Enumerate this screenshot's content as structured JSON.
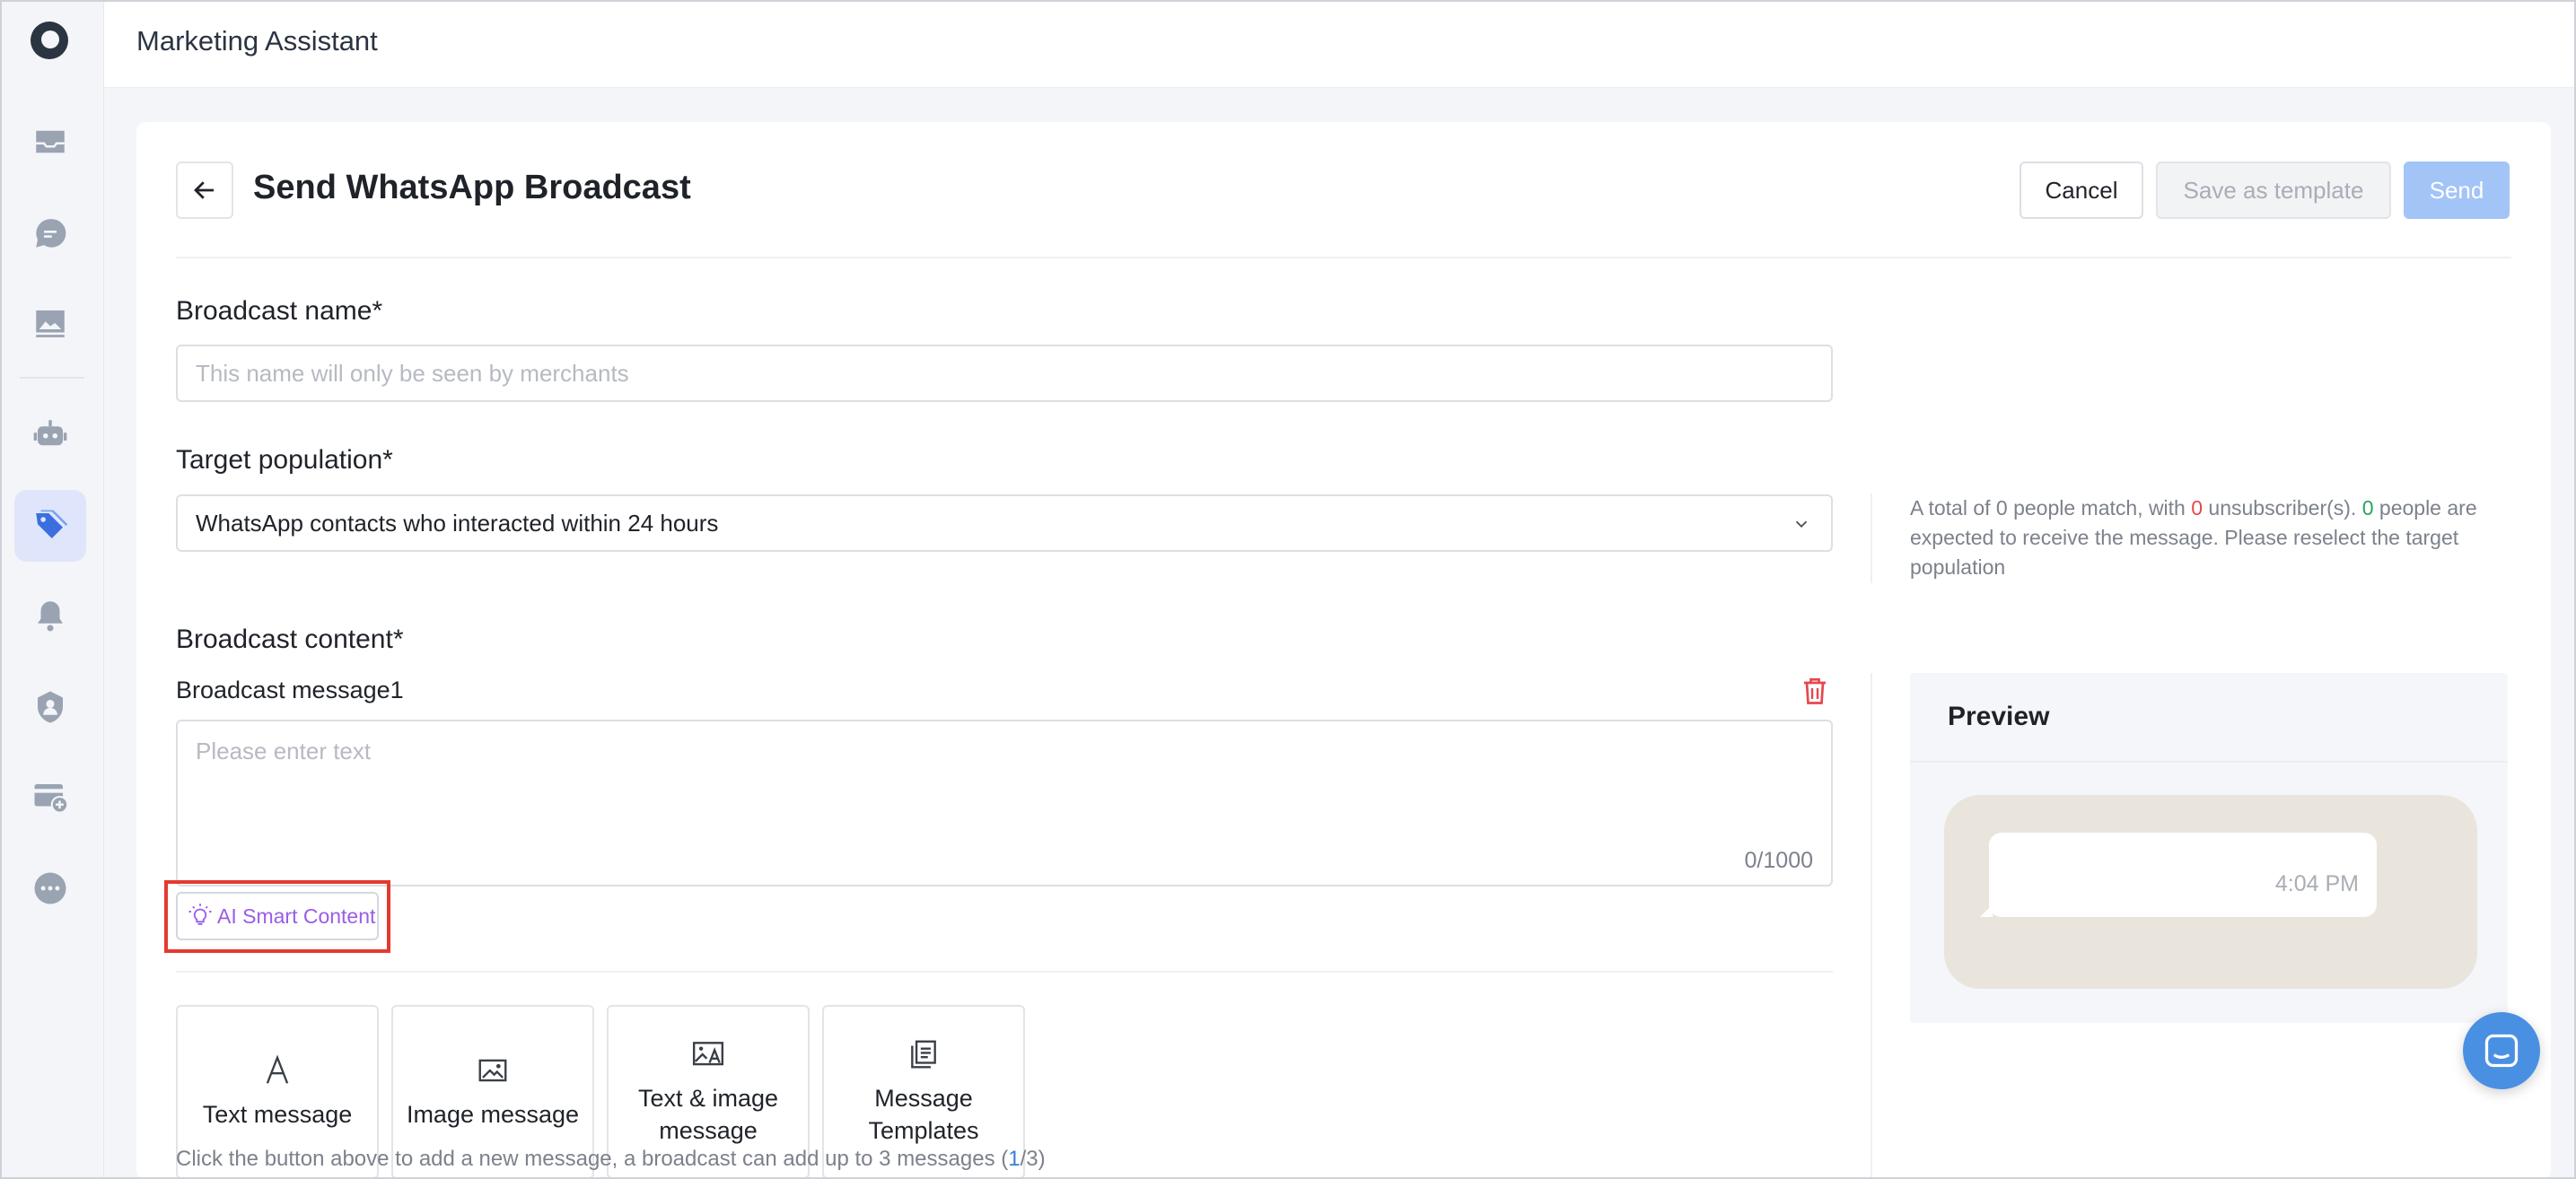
{
  "app": {
    "title": "Marketing Assistant"
  },
  "sidebar": {
    "items": [
      {
        "name": "mail-icon"
      },
      {
        "name": "chat-bubble-icon"
      },
      {
        "name": "image-gallery-icon"
      },
      {
        "name": "robot-icon"
      },
      {
        "name": "tags-icon",
        "active": true
      },
      {
        "name": "bell-icon"
      },
      {
        "name": "shield-user-icon"
      },
      {
        "name": "card-add-icon"
      },
      {
        "name": "more-icon"
      }
    ]
  },
  "page": {
    "title": "Send WhatsApp Broadcast",
    "cancel_label": "Cancel",
    "save_template_label": "Save as template",
    "send_label": "Send"
  },
  "broadcast_name": {
    "label": "Broadcast name*",
    "placeholder": "This name will only be seen by merchants",
    "value": ""
  },
  "target_population": {
    "label": "Target population*",
    "selected": "WhatsApp contacts who interacted within 24 hours",
    "note": {
      "part1": "A total of 0 people match, with ",
      "unsubscribers": "0",
      "part2": " unsubscriber(s). ",
      "receivers": "0",
      "part3": " people are expected to receive the message. Please reselect the target population"
    }
  },
  "content": {
    "label": "Broadcast content*",
    "message_label": "Broadcast message1",
    "placeholder": "Please enter text",
    "counter": "0/1000",
    "ai_label": "AI Smart Content",
    "tiles": [
      {
        "label": "Text message",
        "icon": "text-a-icon"
      },
      {
        "label": "Image message",
        "icon": "image-icon"
      },
      {
        "label": "Text & image message",
        "icon": "text-image-icon"
      },
      {
        "label": "Message Templates",
        "icon": "templates-icon"
      }
    ],
    "hint_prefix": "Click the button above to add a new message, a broadcast can add up to 3 messages  (",
    "hint_current": "1",
    "hint_suffix": "/3)"
  },
  "preview": {
    "title": "Preview",
    "time": "4:04 PM"
  },
  "colors": {
    "accent": "#4a90e2",
    "send_disabled": "#a3c4f7",
    "danger": "#e5484d",
    "success": "#29a35a",
    "ai_purple": "#9b5de5",
    "highlight_frame": "#e5392e"
  }
}
